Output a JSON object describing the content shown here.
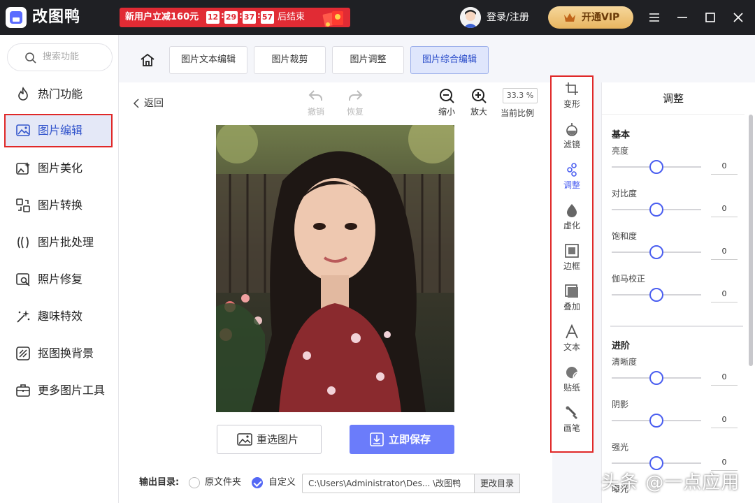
{
  "titlebar": {
    "app_name": "改图鸭",
    "promo_text": "新用户立减160元",
    "timer": [
      "12",
      "29",
      "37",
      "57"
    ],
    "promo_end": "后结束",
    "login": "登录/注册",
    "vip": "开通VIP"
  },
  "sidebar": {
    "search_placeholder": "搜索功能",
    "items": [
      {
        "label": "热门功能",
        "icon": "fire-icon"
      },
      {
        "label": "图片编辑",
        "icon": "image-edit-icon",
        "active": true
      },
      {
        "label": "图片美化",
        "icon": "image-beauty-icon"
      },
      {
        "label": "图片转换",
        "icon": "convert-icon"
      },
      {
        "label": "图片批处理",
        "icon": "batch-icon"
      },
      {
        "label": "照片修复",
        "icon": "repair-icon"
      },
      {
        "label": "趣味特效",
        "icon": "sparkle-icon"
      },
      {
        "label": "抠图换背景",
        "icon": "cutout-icon"
      },
      {
        "label": "更多图片工具",
        "icon": "toolbox-icon"
      }
    ]
  },
  "tabs": [
    {
      "label": "图片文本编辑"
    },
    {
      "label": "图片裁剪"
    },
    {
      "label": "图片调整"
    },
    {
      "label": "图片综合编辑",
      "active": true
    }
  ],
  "canvas": {
    "back": "返回",
    "undo": "撤销",
    "redo": "恢复",
    "zoom_out": "缩小",
    "zoom_in": "放大",
    "zoom_value": "33.3 %",
    "zoom_label": "当前比例",
    "reselect": "重选图片",
    "save": "立即保存",
    "output_label": "输出目录:",
    "original_folder": "原文件夹",
    "custom": "自定义",
    "path": "C:\\Users\\Administrator\\Des... \\改图鸭",
    "change_dir": "更改目录"
  },
  "toolcol": [
    {
      "label": "变形",
      "icon": "transform-icon"
    },
    {
      "label": "滤镜",
      "icon": "filter-icon"
    },
    {
      "label": "调整",
      "icon": "adjust-icon",
      "active": true
    },
    {
      "label": "虚化",
      "icon": "blur-icon"
    },
    {
      "label": "边框",
      "icon": "border-icon"
    },
    {
      "label": "叠加",
      "icon": "overlay-icon"
    },
    {
      "label": "文本",
      "icon": "text-icon"
    },
    {
      "label": "贴纸",
      "icon": "sticker-icon"
    },
    {
      "label": "画笔",
      "icon": "brush-icon"
    }
  ],
  "panel": {
    "title": "调整",
    "basic_title": "基本",
    "basic": [
      {
        "label": "亮度",
        "value": "0"
      },
      {
        "label": "对比度",
        "value": "0"
      },
      {
        "label": "饱和度",
        "value": "0"
      },
      {
        "label": "伽马校正",
        "value": "0"
      }
    ],
    "advanced_title": "进阶",
    "advanced": [
      {
        "label": "清晰度",
        "value": "0"
      },
      {
        "label": "阴影",
        "value": "0"
      },
      {
        "label": "强光",
        "value": "0"
      },
      {
        "label": "曝光",
        "value": ""
      }
    ]
  },
  "watermark": "头条 @一点应用",
  "colors": {
    "accent": "#6b7cfa",
    "highlight_border": "#e02828",
    "titlebar": "#1f2024"
  }
}
